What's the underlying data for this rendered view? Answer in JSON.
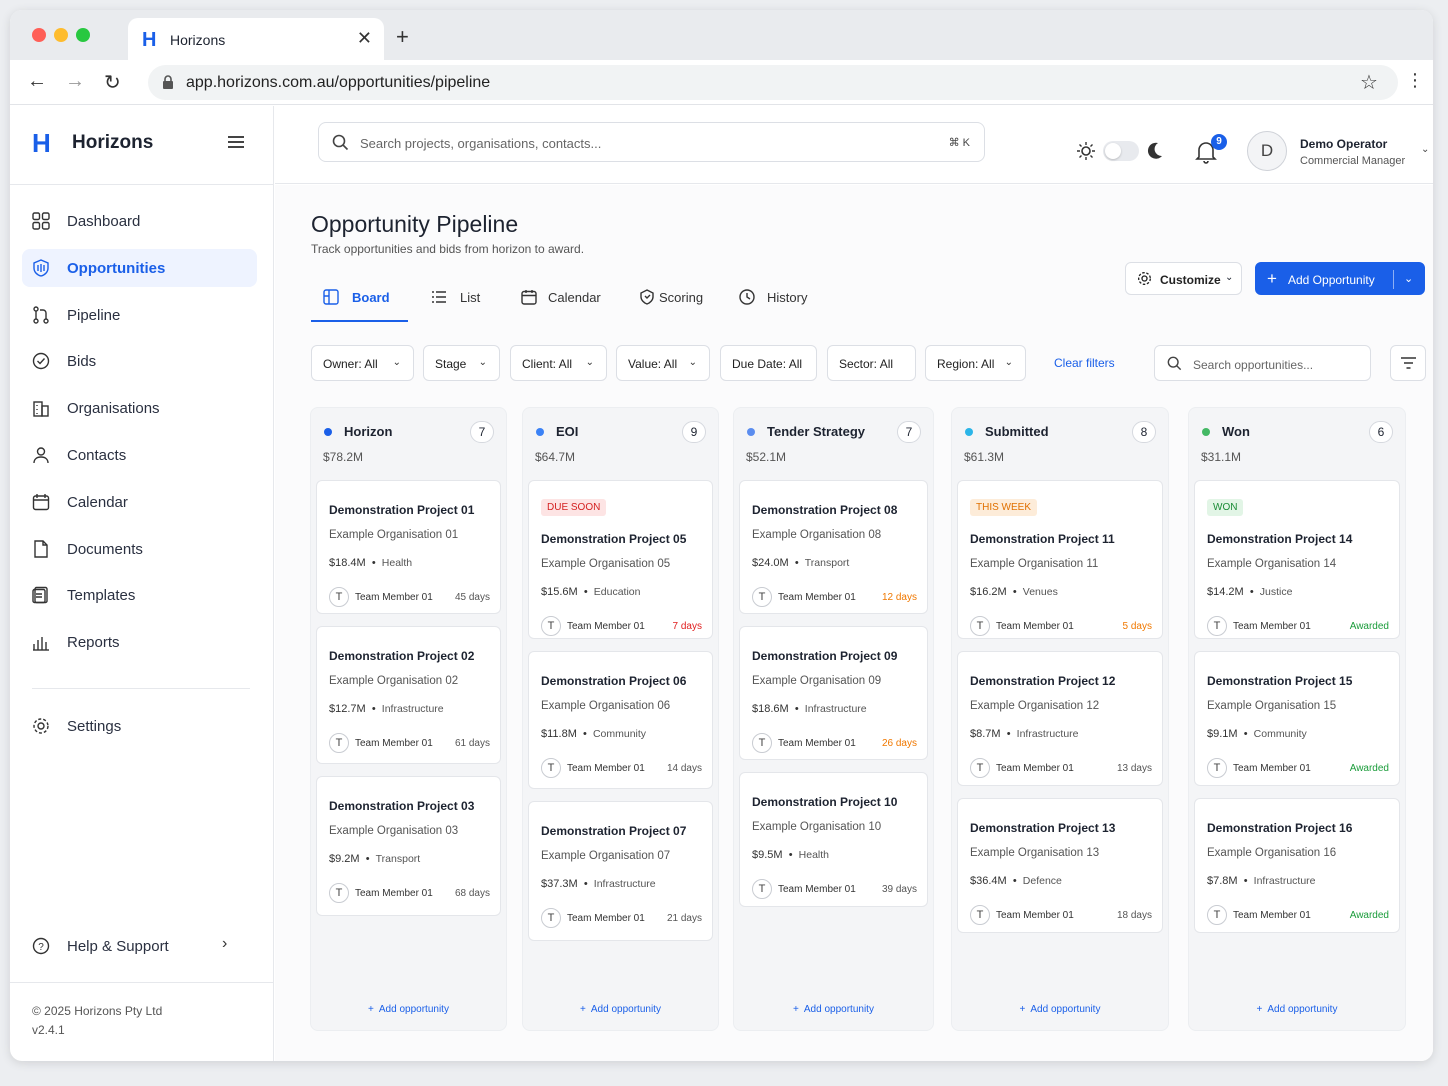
{
  "browser": {
    "tab_title": "Horizons",
    "url": "app.horizons.com.au/opportunities/pipeline"
  },
  "brand": {
    "logo": "H",
    "name": "Horizons"
  },
  "sidebar": {
    "items": [
      {
        "label": "Dashboard",
        "icon": "grid-icon"
      },
      {
        "label": "Opportunities",
        "icon": "target-icon",
        "active": true
      },
      {
        "label": "Pipeline",
        "icon": "pipeline-icon"
      },
      {
        "label": "Bids",
        "icon": "check-circle-icon"
      },
      {
        "label": "Organisations",
        "icon": "building-icon"
      },
      {
        "label": "Contacts",
        "icon": "person-icon"
      },
      {
        "label": "Calendar",
        "icon": "calendar-icon"
      },
      {
        "label": "Documents",
        "icon": "document-icon"
      },
      {
        "label": "Templates",
        "icon": "template-icon"
      },
      {
        "label": "Reports",
        "icon": "bar-chart-icon"
      }
    ],
    "settings": "Settings",
    "help": "Help & Support",
    "copyright": "© 2025 Horizons Pty Ltd",
    "version": "v2.4.1"
  },
  "topbar": {
    "search_placeholder": "Search projects, organisations, contacts...",
    "shortcut": "⌘ K",
    "notifications": "9",
    "user_initial": "D",
    "user_name": "Demo Operator",
    "user_role": "Commercial Manager"
  },
  "page": {
    "title": "Opportunity Pipeline",
    "subtitle": "Track opportunities and bids from horizon to award.",
    "customize": "Customize",
    "add": "Add Opportunity"
  },
  "tabs": [
    "Board",
    "List",
    "Calendar",
    "Scoring",
    "History"
  ],
  "filters": {
    "items": [
      "Owner: All",
      "Stage",
      "Client: All",
      "Value: All",
      "Due Date: All",
      "Sector: All",
      "Region: All"
    ],
    "clear": "Clear filters",
    "search_placeholder": "Search opportunities..."
  },
  "columns": [
    {
      "name": "Horizon",
      "count": "7",
      "value": "$78.2M",
      "color": "#1a5fe8",
      "cards": [
        {
          "title": "Demonstration Project 01",
          "org": "Example Organisation 01",
          "value": "$18.4M",
          "sector": "Health",
          "member": "Team Member 01",
          "days": "45 days"
        },
        {
          "title": "Demonstration Project 02",
          "org": "Example Organisation 02",
          "value": "$12.7M",
          "sector": "Infrastructure",
          "member": "Team Member 01",
          "days": "61 days"
        },
        {
          "title": "Demonstration Project 03",
          "org": "Example Organisation 03",
          "value": "$9.2M",
          "sector": "Transport",
          "member": "Team Member 01",
          "days": "68 days"
        }
      ]
    },
    {
      "name": "EOI",
      "count": "9",
      "value": "$64.7M",
      "color": "#3b82f6",
      "cards": [
        {
          "badge": "DUE SOON",
          "title": "Demonstration Project 05",
          "org": "Example Organisation 05",
          "value": "$15.6M",
          "sector": "Education",
          "member": "Team Member 01",
          "days": "7 days"
        },
        {
          "title": "Demonstration Project 06",
          "org": "Example Organisation 06",
          "value": "$11.8M",
          "sector": "Community",
          "member": "Team Member 01",
          "days": "14 days"
        },
        {
          "title": "Demonstration Project 07",
          "org": "Example Organisation 07",
          "value": "$37.3M",
          "sector": "Infrastructure",
          "member": "Team Member 01",
          "days": "21 days"
        }
      ]
    },
    {
      "name": "Tender Strategy",
      "count": "7",
      "value": "$52.1M",
      "color": "#5b8def",
      "cards": [
        {
          "title": "Demonstration Project 08",
          "org": "Example Organisation 08",
          "value": "$24.0M",
          "sector": "Transport",
          "member": "Team Member 01",
          "days": "12 days"
        },
        {
          "title": "Demonstration Project 09",
          "org": "Example Organisation 09",
          "value": "$18.6M",
          "sector": "Infrastructure",
          "member": "Team Member 01",
          "days": "26 days"
        },
        {
          "title": "Demonstration Project 10",
          "org": "Example Organisation 10",
          "value": "$9.5M",
          "sector": "Health",
          "member": "Team Member 01",
          "days": "39 days"
        }
      ]
    },
    {
      "name": "Submitted",
      "count": "8",
      "value": "$61.3M",
      "color": "#2bb5e8",
      "cards": [
        {
          "badge": "THIS WEEK",
          "title": "Demonstration Project 11",
          "org": "Example Organisation 11",
          "value": "$16.2M",
          "sector": "Venues",
          "member": "Team Member 01",
          "days": "5 days"
        },
        {
          "title": "Demonstration Project 12",
          "org": "Example Organisation 12",
          "value": "$8.7M",
          "sector": "Infrastructure",
          "member": "Team Member 01",
          "days": "13 days"
        },
        {
          "title": "Demonstration Project 13",
          "org": "Example Organisation 13",
          "value": "$36.4M",
          "sector": "Defence",
          "member": "Team Member 01",
          "days": "18 days"
        }
      ]
    },
    {
      "name": "Won",
      "count": "6",
      "value": "$31.1M",
      "color": "#43b864",
      "cards": [
        {
          "badge": "WON",
          "title": "Demonstration Project 14",
          "org": "Example Organisation 14",
          "value": "$14.2M",
          "sector": "Justice",
          "member": "Team Member 01",
          "days": "Awarded"
        },
        {
          "title": "Demonstration Project 15",
          "org": "Example Organisation 15",
          "value": "$9.1M",
          "sector": "Community",
          "member": "Team Member 01",
          "days": "Awarded"
        },
        {
          "title": "Demonstration Project 16",
          "org": "Example Organisation 16",
          "value": "$7.8M",
          "sector": "Infrastructure",
          "member": "Team Member 01",
          "days": "Awarded"
        }
      ]
    }
  ],
  "add_opportunity": "Add opportunity"
}
